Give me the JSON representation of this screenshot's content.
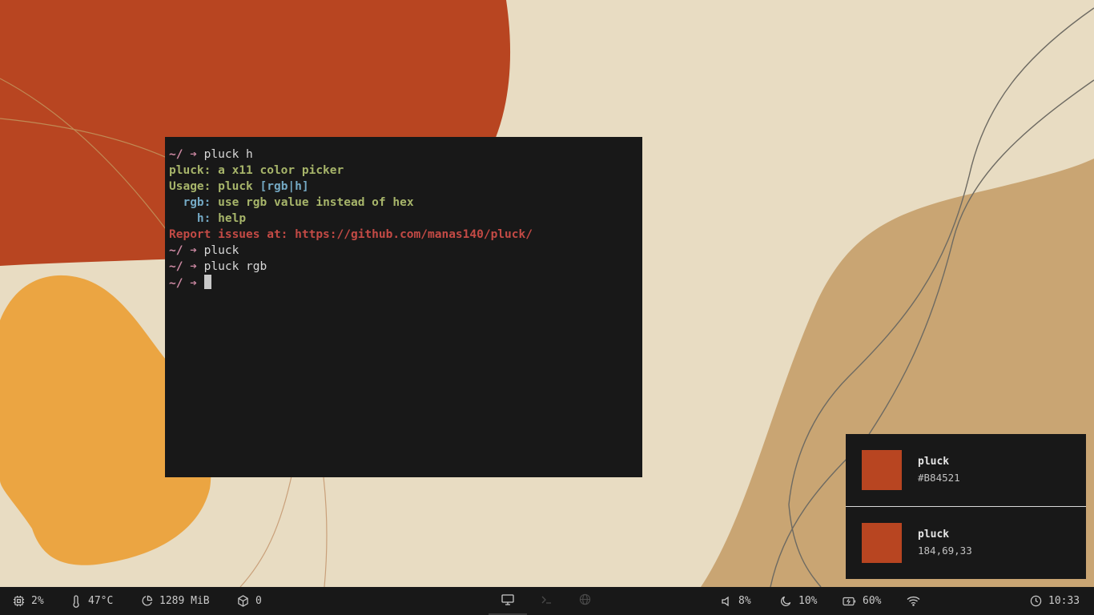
{
  "colors": {
    "accent": "#B84521",
    "terminal_bg": "#181818",
    "prompt": "#d08ba5",
    "help_green": "#a7b56a",
    "help_blue": "#74a9c4",
    "error_red": "#c34a45"
  },
  "terminal": {
    "lines": {
      "l1": {
        "prompt": "~/ ➔",
        "cmd": "pluck h"
      },
      "l2": "pluck: a x11 color picker",
      "l3": {
        "label": "Usage:",
        "cmd": "pluck",
        "args": "[rgb|h]"
      },
      "l4": {
        "key": "rgb:",
        "desc": "use rgb value instead of hex"
      },
      "l5": {
        "key": "h:",
        "desc": "help"
      },
      "l6": "Report issues at: https://github.com/manas140/pluck/",
      "l7": {
        "prompt": "~/ ➔",
        "cmd": "pluck"
      },
      "l8": {
        "prompt": "~/ ➔",
        "cmd": "pluck rgb"
      },
      "l9": {
        "prompt": "~/ ➔"
      }
    }
  },
  "notifications": [
    {
      "title": "pluck",
      "body": "#B84521",
      "swatch": "#B84521"
    },
    {
      "title": "pluck",
      "body": "184,69,33",
      "swatch": "#B84521"
    }
  ],
  "statusbar": {
    "cpu": {
      "icon": "cpu-icon",
      "value": "2%"
    },
    "temperature": {
      "icon": "thermometer-icon",
      "value": "47°C"
    },
    "memory": {
      "icon": "pie-chart-icon",
      "value": "1289 MiB"
    },
    "updates": {
      "icon": "package-icon",
      "value": "0"
    },
    "workspaces": [
      {
        "icon": "monitor-icon",
        "active": true
      },
      {
        "icon": "terminal-icon",
        "active": false
      },
      {
        "icon": "globe-icon",
        "active": false
      }
    ],
    "volume": {
      "icon": "speaker-icon",
      "value": "8%"
    },
    "brightness": {
      "icon": "moon-icon",
      "value": "10%"
    },
    "battery": {
      "icon": "battery-charging-icon",
      "value": "60%"
    },
    "wifi": {
      "icon": "wifi-icon"
    },
    "clock": {
      "icon": "clock-icon",
      "value": "10:33"
    }
  }
}
